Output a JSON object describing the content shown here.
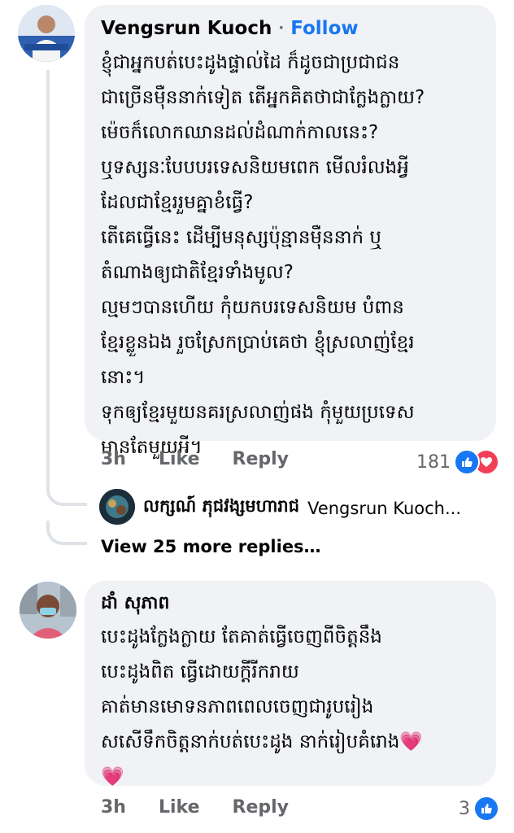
{
  "comments": [
    {
      "author": "Vengsrun Kuoch",
      "follow_label": "Follow",
      "text": "ខ្ញុំជាអ្នកបត់បេះដូងផ្ទាល់ដៃ ក៏ដូចជាប្រជាជន\nជាច្រើនម៉ឺននាក់ទៀត តើអ្នកគិតថាជាក្លែងក្លាយ?\nម៉េចក៏លោកឈានដល់ដំណាក់កាលនេះ?\nឬទស្សនៈបែបបរទេសនិយមពេក មើលរំលងអ្វី\nដែលជាខ្មែររួមគ្នាខំធ្វើ?\nតើគេធ្វើនេះ ដើម្បីមនុស្សប៉ុន្មានម៉ឺននាក់ ឬ\nតំណាងឲ្យជាតិខ្មែរទាំងមូល?\nល្មមៗបានហើយ កុំយកបរទេសនិយម បំពាន\nខ្មែរខ្លួនឯង រួចស្រែកប្រាប់គេថា ខ្ញុំស្រលាញ់ខ្មែរ\nនោះ។\nទុកឲ្យខ្មែរមួយនគរស្រលាញ់ផង កុំមួយប្រទេស\nមានតែមួយអី។",
      "time": "3h",
      "like_label": "Like",
      "reply_label": "Reply",
      "reaction_count": "181",
      "reaction_icons": [
        "like-icon",
        "love-icon"
      ]
    },
    {
      "author": "ដាំ សុភាព",
      "text": "បេះដូងក្លែងក្លាយ តែគាត់ធ្វើចេញពីចិត្តនឹង\nបេះដូងពិត ធ្វើដោយក្តីរីករាយ\nគាត់មានមោទនភាពពេលចេញជារូបរៀង\nសសើទឹកចិត្តនាក់បត់បេះដូង នាក់រៀបគំរោង💗\n💗",
      "time": "3h",
      "like_label": "Like",
      "reply_label": "Reply",
      "reaction_count": "3",
      "reaction_icons": [
        "like-icon"
      ]
    }
  ],
  "reply_preview": {
    "author": "លក្សណ៍ ភុជវង្សមហារាជ",
    "snippet": "Vengsrun Kuoch..."
  },
  "view_more": "View 25 more replies…",
  "colors": {
    "bubble": "#f0f2f5",
    "link": "#1877f2",
    "meta": "#65676b",
    "love": "#f33e58"
  }
}
